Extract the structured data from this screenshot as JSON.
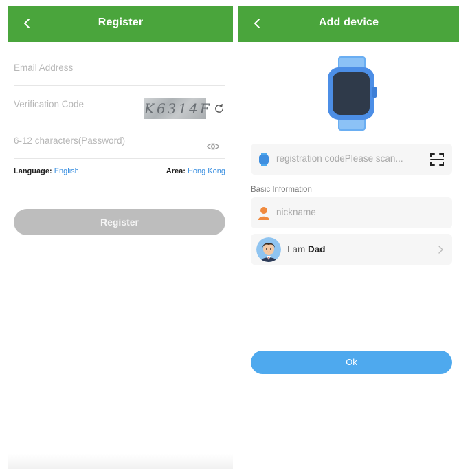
{
  "register_screen": {
    "title": "Register",
    "email_placeholder": "Email Address",
    "code_placeholder": "Verification Code",
    "captcha_text": "K6314F",
    "password_placeholder": "6-12 characters(Password)",
    "language_label": "Language:",
    "language_value": "English",
    "area_label": "Area:",
    "area_value": "Hong Kong",
    "register_button": "Register"
  },
  "add_device_screen": {
    "title": "Add device",
    "registration_placeholder": "registration codePlease scan...",
    "section_basic": "Basic Information",
    "nickname_placeholder": "nickname",
    "relation_prefix": "I am",
    "relation_value": "Dad",
    "ok_button": "Ok"
  },
  "colors": {
    "nav_green": "#4aa53c",
    "link_blue": "#3a8fe0",
    "ok_blue": "#4ea9ee",
    "disabled_gray": "#bdbdbd",
    "nickname_icon_orange": "#f08a3e"
  },
  "icons": {
    "back": "chevron-left-icon",
    "refresh": "refresh-icon",
    "eye": "eye-icon",
    "watch": "smartwatch-icon",
    "scan": "scan-icon",
    "person": "person-icon",
    "chevron": "chevron-right-icon"
  }
}
